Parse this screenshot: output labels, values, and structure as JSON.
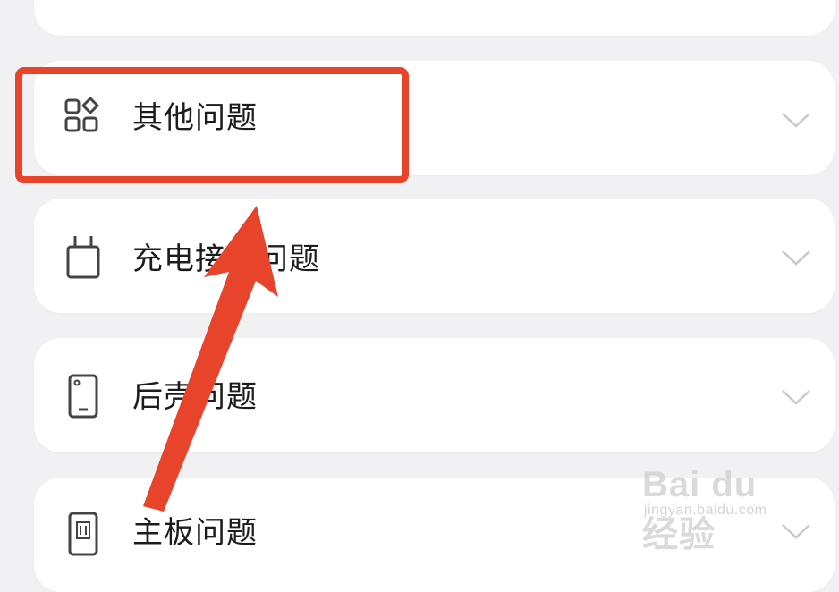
{
  "rows": [
    {
      "label": "",
      "icon": "device-icon"
    },
    {
      "label": "其他问题",
      "icon": "apps-grid-icon"
    },
    {
      "label": "充电接口问题",
      "icon": "charger-plug-icon"
    },
    {
      "label": "后壳问题",
      "icon": "phone-back-icon"
    },
    {
      "label": "主板问题",
      "icon": "mainboard-icon"
    }
  ],
  "annotation": {
    "highlight_color": "#e8432b",
    "arrow_color": "#e8432b"
  },
  "watermark": {
    "logo": "Bai du 经验",
    "url": "jingyan.baidu.com"
  },
  "colors": {
    "background": "#f1f1f3",
    "card": "#ffffff",
    "text": "#1c1c1c",
    "chevron": "#c9c9cc"
  }
}
